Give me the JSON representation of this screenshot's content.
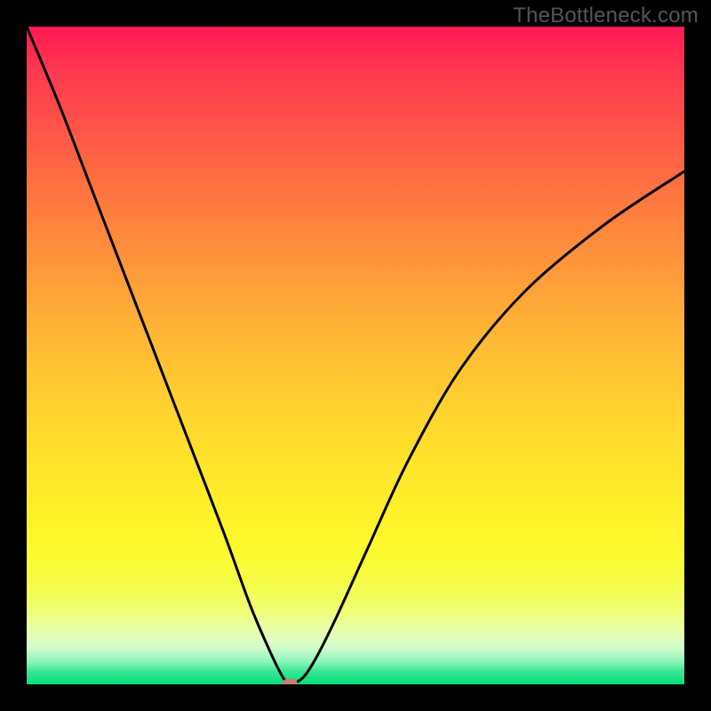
{
  "watermark": "TheBottleneck.com",
  "chart_data": {
    "type": "line",
    "title": "",
    "xlabel": "",
    "ylabel": "",
    "xlim": [
      0,
      100
    ],
    "ylim": [
      0,
      100
    ],
    "grid": false,
    "series": [
      {
        "name": "bottleneck-curve",
        "x": [
          0,
          5,
          10,
          15,
          20,
          25,
          30,
          34,
          37,
          39,
          40,
          42,
          44,
          47,
          52,
          58,
          66,
          76,
          88,
          100
        ],
        "values": [
          100,
          88,
          75,
          62,
          49,
          36,
          23,
          12,
          5,
          1,
          0,
          1,
          4,
          10,
          21,
          34,
          48,
          60,
          70,
          78
        ]
      }
    ],
    "marker": {
      "x": 40,
      "y": 0,
      "color": "#d07878"
    },
    "gradient_stops": [
      {
        "pos": 0,
        "color": "#ff1955"
      },
      {
        "pos": 0.5,
        "color": "#ffc431"
      },
      {
        "pos": 0.8,
        "color": "#fdfb2e"
      },
      {
        "pos": 1.0,
        "color": "#00e07a"
      }
    ]
  }
}
